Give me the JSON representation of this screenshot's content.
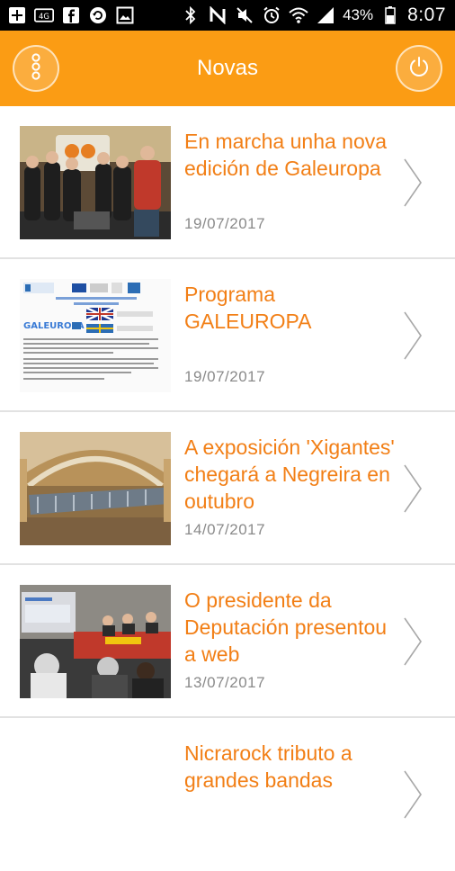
{
  "status_bar": {
    "icons_left": [
      "add-box-icon",
      "data-saver-icon",
      "facebook-icon",
      "reload-icon",
      "image-icon"
    ],
    "icons_right": [
      "bluetooth-icon",
      "nfc-icon",
      "mute-icon",
      "alarm-icon",
      "wifi-icon",
      "signal-icon"
    ],
    "battery": "43%",
    "time": "8:07"
  },
  "header": {
    "title": "Novas",
    "menu_icon": "more-vert-icon",
    "power_icon": "power-icon",
    "color": "#FB9C14"
  },
  "news": [
    {
      "title": "En marcha unha nova edición de Galeuropa",
      "date": "19/07/2017"
    },
    {
      "title": "Programa GALEUROPA",
      "date": "19/07/2017"
    },
    {
      "title": "A exposición 'Xigantes' chegará a Negreira en outubro",
      "date": "14/07/2017"
    },
    {
      "title": "O presidente da Deputación presentou a web",
      "date": "13/07/2017"
    },
    {
      "title": "Nicrarock tributo a grandes bandas",
      "date": ""
    }
  ],
  "colors": {
    "title": "#F27F16",
    "date": "#8a8a8a",
    "divider": "#e2e2e2"
  }
}
